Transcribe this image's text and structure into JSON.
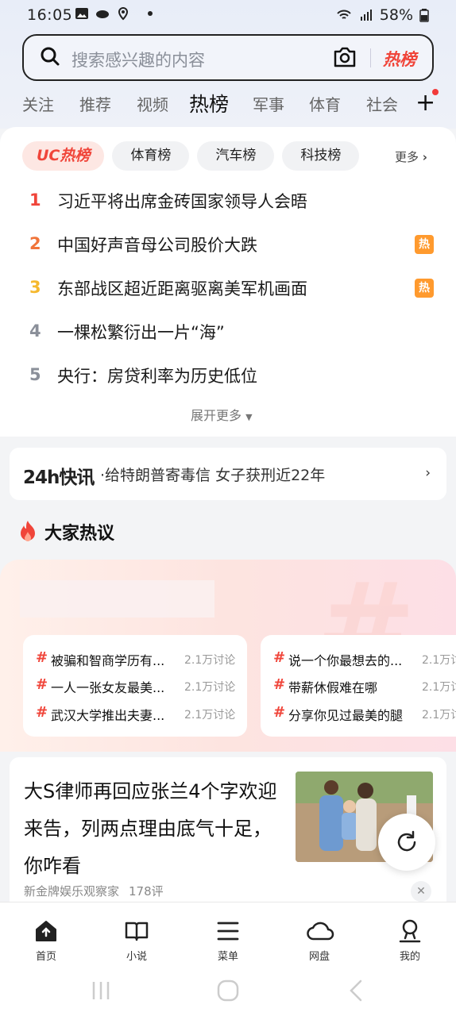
{
  "status": {
    "time": "16:05",
    "battery": "58%"
  },
  "search": {
    "placeholder": "搜索感兴趣的内容",
    "hot_label": "热榜"
  },
  "tabs": [
    "关注",
    "推荐",
    "视频",
    "热榜",
    "军事",
    "体育",
    "社会"
  ],
  "active_tab": "热榜",
  "chips": [
    "UC热榜",
    "体育榜",
    "汽车榜",
    "科技榜"
  ],
  "chips_more": "更多",
  "ranking": [
    {
      "num": "1",
      "text": "习近平将出席金砖国家领导人会晤",
      "badge": "",
      "color": "#f0453a"
    },
    {
      "num": "2",
      "text": "中国好声音母公司股价大跌",
      "badge": "热",
      "color": "#f0743a"
    },
    {
      "num": "3",
      "text": "东部战区超近距离驱离美军机画面",
      "badge": "热",
      "color": "#f5b82e"
    },
    {
      "num": "4",
      "text": "一棵松繁衍出一片“海”",
      "badge": "",
      "color": "#8a8f99"
    },
    {
      "num": "5",
      "text": "央行：房贷利率为历史低位",
      "badge": "",
      "color": "#8a8f99"
    }
  ],
  "expand_more": "展开更多",
  "flash": {
    "logo": "24h快讯",
    "message": "·给特朗普寄毒信 女子获刑近22年"
  },
  "hot_discuss": {
    "title": "大家热议",
    "left": [
      {
        "topic": "被骗和智商学历有...",
        "count": "2.1万讨论"
      },
      {
        "topic": "一人一张女友最美...",
        "count": "2.1万讨论"
      },
      {
        "topic": "武汉大学推出夫妻...",
        "count": "2.1万讨论"
      }
    ],
    "right": [
      {
        "topic": "说一个你最想去的...",
        "count": "2.1万讨"
      },
      {
        "topic": "带薪休假难在哪",
        "count": "2.1万讨"
      },
      {
        "topic": "分享你见过最美的腿",
        "count": "2.1万讨"
      }
    ]
  },
  "news": {
    "headline": "大S律师再回应张兰4个字欢迎来告，列两点理由底气十足，你咋看",
    "source": "新金牌娱乐观察家",
    "comments": "178评"
  },
  "bottom_nav": [
    "首页",
    "小说",
    "菜单",
    "网盘",
    "我的"
  ],
  "colors": {
    "accent": "#f0453a",
    "badge": "#ff9a2e"
  }
}
